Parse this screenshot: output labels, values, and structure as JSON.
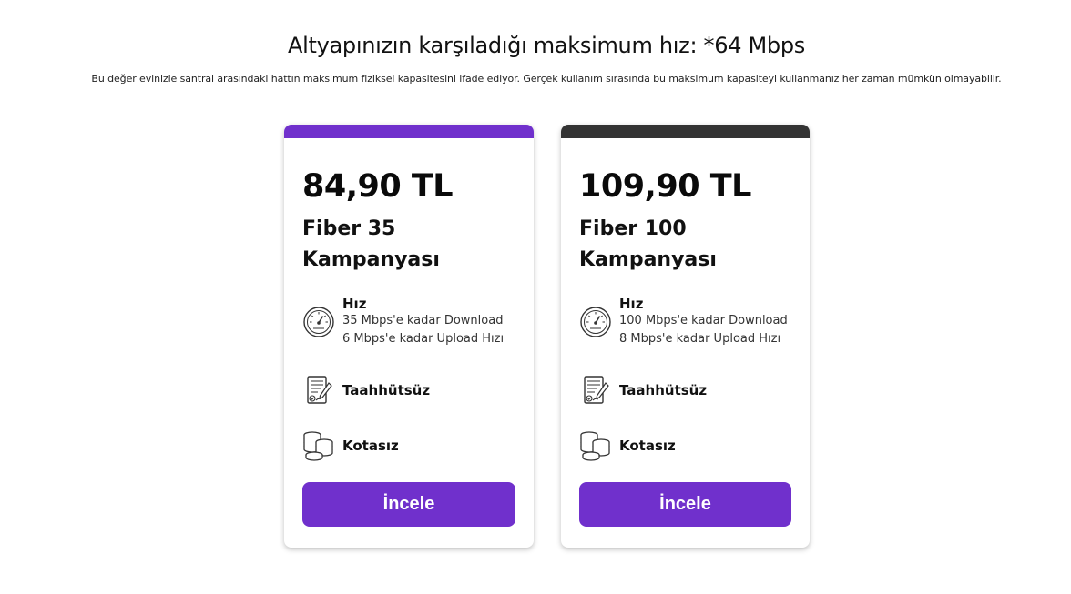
{
  "header": {
    "title": "Altyapınızın karşıladığı maksimum hız: *64 Mbps",
    "subtitle": "Bu değer evinizle santral arasındaki hattın maksimum fiziksel kapasitesini ifade ediyor. Gerçek kullanım sırasında bu maksimum kapasiteyi kullanmanız her zaman mümkün olmayabilir."
  },
  "colors": {
    "accent": "#7030cc",
    "dark_bar": "#333333"
  },
  "plans": [
    {
      "price": "84,90 TL",
      "name": "Fiber 35 Kampanyası",
      "speed_title": "Hız",
      "download": "35 Mbps'e kadar Download",
      "upload": "6 Mbps'e kadar Upload Hızı",
      "commitment": "Taahhütsüz",
      "quota": "Kotasız",
      "button": "İncele",
      "bar_color": "#7030cc"
    },
    {
      "price": "109,90 TL",
      "name": "Fiber 100 Kampanyası",
      "speed_title": "Hız",
      "download": "100 Mbps'e kadar Download",
      "upload": "8 Mbps'e kadar Upload Hızı",
      "commitment": "Taahhütsüz",
      "quota": "Kotasız",
      "button": "İncele",
      "bar_color": "#333333"
    }
  ],
  "icons": {
    "speed": "speedometer-icon",
    "commitment": "contract-icon",
    "quota": "coins-icon"
  }
}
